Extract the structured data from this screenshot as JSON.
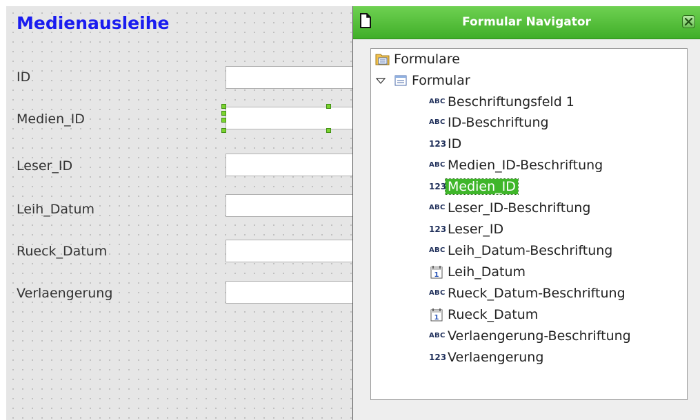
{
  "form": {
    "title": "Medienausleihe",
    "labels": [
      "ID",
      "Medien_ID",
      "Leser_ID",
      "Leih_Datum",
      "Rueck_Datum",
      "Verlaengerung"
    ]
  },
  "navigator": {
    "title": "Formular Navigator",
    "tree": [
      {
        "label": "Formulare",
        "icon": "forms-folder-icon",
        "indent": 0,
        "selected": false
      },
      {
        "label": "Formular",
        "icon": "form-icon",
        "indent": 1,
        "expanded": true,
        "selected": false
      },
      {
        "label": "Beschriftungsfeld 1",
        "icon": "label-field-icon",
        "indent": 2,
        "selected": false
      },
      {
        "label": "ID-Beschriftung",
        "icon": "label-field-icon",
        "indent": 2,
        "selected": false
      },
      {
        "label": "ID",
        "icon": "numeric-field-icon",
        "indent": 2,
        "selected": false
      },
      {
        "label": "Medien_ID-Beschriftung",
        "icon": "label-field-icon",
        "indent": 2,
        "selected": false
      },
      {
        "label": "Medien_ID",
        "icon": "numeric-field-icon",
        "indent": 2,
        "selected": true
      },
      {
        "label": "Leser_ID-Beschriftung",
        "icon": "label-field-icon",
        "indent": 2,
        "selected": false
      },
      {
        "label": "Leser_ID",
        "icon": "numeric-field-icon",
        "indent": 2,
        "selected": false
      },
      {
        "label": "Leih_Datum-Beschriftung",
        "icon": "label-field-icon",
        "indent": 2,
        "selected": false
      },
      {
        "label": "Leih_Datum",
        "icon": "date-field-icon",
        "indent": 2,
        "selected": false
      },
      {
        "label": "Rueck_Datum-Beschriftung",
        "icon": "label-field-icon",
        "indent": 2,
        "selected": false
      },
      {
        "label": "Rueck_Datum",
        "icon": "date-field-icon",
        "indent": 2,
        "selected": false
      },
      {
        "label": "Verlaengerung-Beschriftung",
        "icon": "label-field-icon",
        "indent": 2,
        "selected": false
      },
      {
        "label": "Verlaengerung",
        "icon": "numeric-field-icon",
        "indent": 2,
        "selected": false
      }
    ],
    "icon_text": {
      "label_field": "ABC",
      "numeric_field": "123",
      "date_field": "1"
    }
  },
  "colors": {
    "title_blue": "#1a1cf0",
    "titlebar_green": "#4cbf33",
    "selection_green": "#3fb62a",
    "handle_green": "#7bd32f"
  }
}
